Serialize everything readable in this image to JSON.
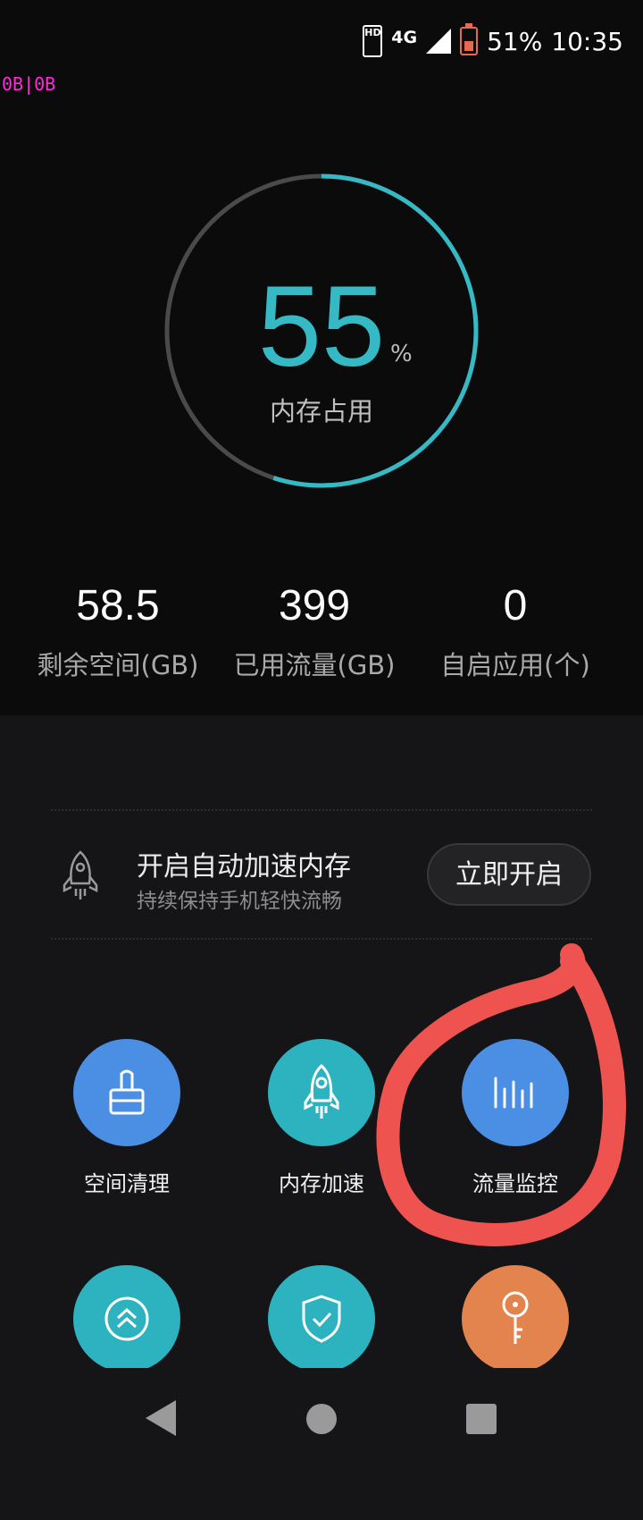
{
  "status_bar": {
    "hd": "HD",
    "network": "4G",
    "battery": "51%",
    "time": "10:35"
  },
  "debug_overlay": "0B|0B",
  "memory_gauge": {
    "value": "55",
    "unit": "%",
    "label": "内存占用",
    "fraction": 0.55,
    "accent_color": "#35b9c4",
    "track_color": "#4a4a4a"
  },
  "stats": [
    {
      "value": "58.5",
      "label": "剩余空间(GB)"
    },
    {
      "value": "399",
      "label": "已用流量(GB)"
    },
    {
      "value": "0",
      "label": "自启应用(个)"
    }
  ],
  "promo": {
    "title": "开启自动加速内存",
    "subtitle": "持续保持手机轻快流畅",
    "button": "立即开启",
    "icon": "rocket-icon"
  },
  "tools": [
    {
      "label": "空间清理",
      "icon": "brush-icon",
      "color": "#4a8fe3"
    },
    {
      "label": "内存加速",
      "icon": "rocket-icon",
      "color": "#2db3bf"
    },
    {
      "label": "流量监控",
      "icon": "bar-chart-icon",
      "color": "#4a8fe3"
    },
    {
      "label": "",
      "icon": "double-chevron-up-icon",
      "color": "#2db3bf"
    },
    {
      "label": "",
      "icon": "shield-check-icon",
      "color": "#2db3bf"
    },
    {
      "label": "",
      "icon": "key-icon",
      "color": "#e3844e"
    }
  ],
  "annotation_color": "#ef5350",
  "nav": {
    "back": "back-icon",
    "home": "home-icon",
    "recents": "recents-icon"
  }
}
